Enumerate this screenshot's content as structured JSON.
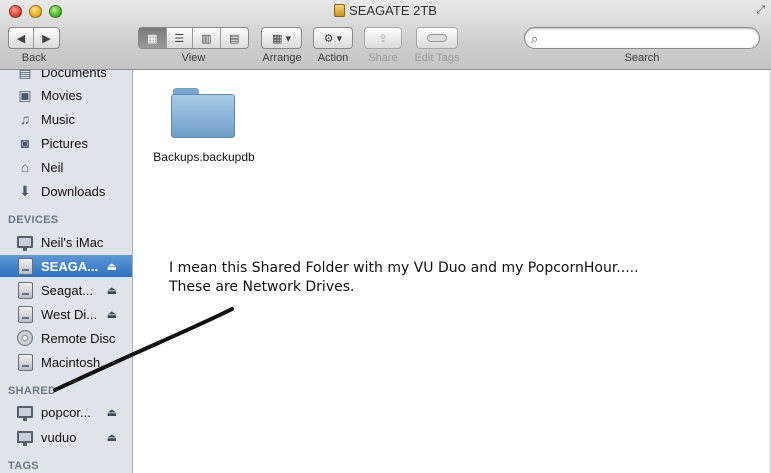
{
  "window": {
    "title": "SEAGATE 2TB"
  },
  "toolbar": {
    "back_label": "Back",
    "view_label": "View",
    "arrange_label": "Arrange",
    "action_label": "Action",
    "share_label": "Share",
    "edit_tags_label": "Edit Tags",
    "search_label": "Search",
    "search_value": ""
  },
  "sidebar": {
    "favorites": [
      {
        "label": "Documents",
        "icon": "documents-icon"
      },
      {
        "label": "Movies",
        "icon": "movies-icon"
      },
      {
        "label": "Music",
        "icon": "music-icon"
      },
      {
        "label": "Pictures",
        "icon": "pictures-icon"
      },
      {
        "label": "Neil",
        "icon": "home-icon"
      },
      {
        "label": "Downloads",
        "icon": "downloads-icon"
      }
    ],
    "devices_header": "DEVICES",
    "devices": [
      {
        "label": "Neil's iMac",
        "icon": "imac-icon"
      },
      {
        "label": "SEAGA...",
        "icon": "external-drive-icon",
        "selected": true,
        "eject": true
      },
      {
        "label": "Seagat...",
        "icon": "external-drive-icon",
        "eject": true
      },
      {
        "label": "West Di...",
        "icon": "external-drive-icon",
        "eject": true
      },
      {
        "label": "Remote Disc",
        "icon": "disc-icon"
      },
      {
        "label": "Macintosh...",
        "icon": "internal-drive-icon"
      }
    ],
    "shared_header": "SHARED",
    "shared": [
      {
        "label": "popcor...",
        "icon": "network-computer-icon",
        "eject": true
      },
      {
        "label": "vuduo",
        "icon": "network-computer-icon",
        "eject": true
      }
    ],
    "tags_header": "TAGS"
  },
  "main": {
    "items": [
      {
        "label": "Backups.backupdb",
        "icon": "folder-icon"
      }
    ],
    "annotation": {
      "line1": "I mean this Shared Folder with my VU Duo and my PopcornHour.....",
      "line2": "These are Network Drives."
    }
  },
  "colors": {
    "selection": "#2b6fc0",
    "sidebar_bg": "#dfe4ea",
    "folder": "#6f9ec8"
  }
}
